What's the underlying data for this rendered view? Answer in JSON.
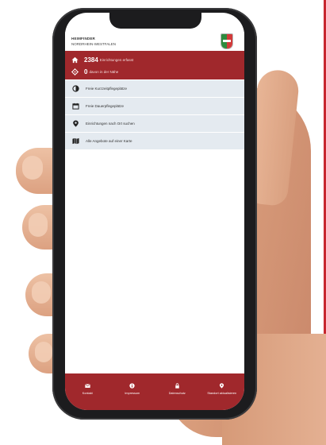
{
  "app": {
    "brand_line1": "HEIMFINDER",
    "brand_line2": "NORDRHEIN-WESTFALEN"
  },
  "banner": {
    "count_value": "2384",
    "count_text": "Einrichtungen erfasst",
    "nearby_value": "0",
    "nearby_text": "davon in der Nähe"
  },
  "menu": [
    {
      "label": "Freie Kurzzeitpflegeplätze",
      "icon": "contrast-icon"
    },
    {
      "label": "Freie Dauerpflegeplätze",
      "icon": "calendar-icon"
    },
    {
      "label": "Einrichtungen nach Ort suchen",
      "icon": "map-pin-icon"
    },
    {
      "label": "Alle Angebote auf einer Karte",
      "icon": "map-icon"
    }
  ],
  "bottom_nav": [
    {
      "label": "Kontakt",
      "icon": "envelope-icon"
    },
    {
      "label": "Impressum",
      "icon": "info-icon"
    },
    {
      "label": "Datenschutz",
      "icon": "lock-icon"
    },
    {
      "label": "Standort aktualisieren",
      "icon": "location-pin-icon"
    }
  ],
  "colors": {
    "brand_red": "#a0282c",
    "menu_bg": "#e4eaf0",
    "phone_frame": "#1c1c1e"
  }
}
